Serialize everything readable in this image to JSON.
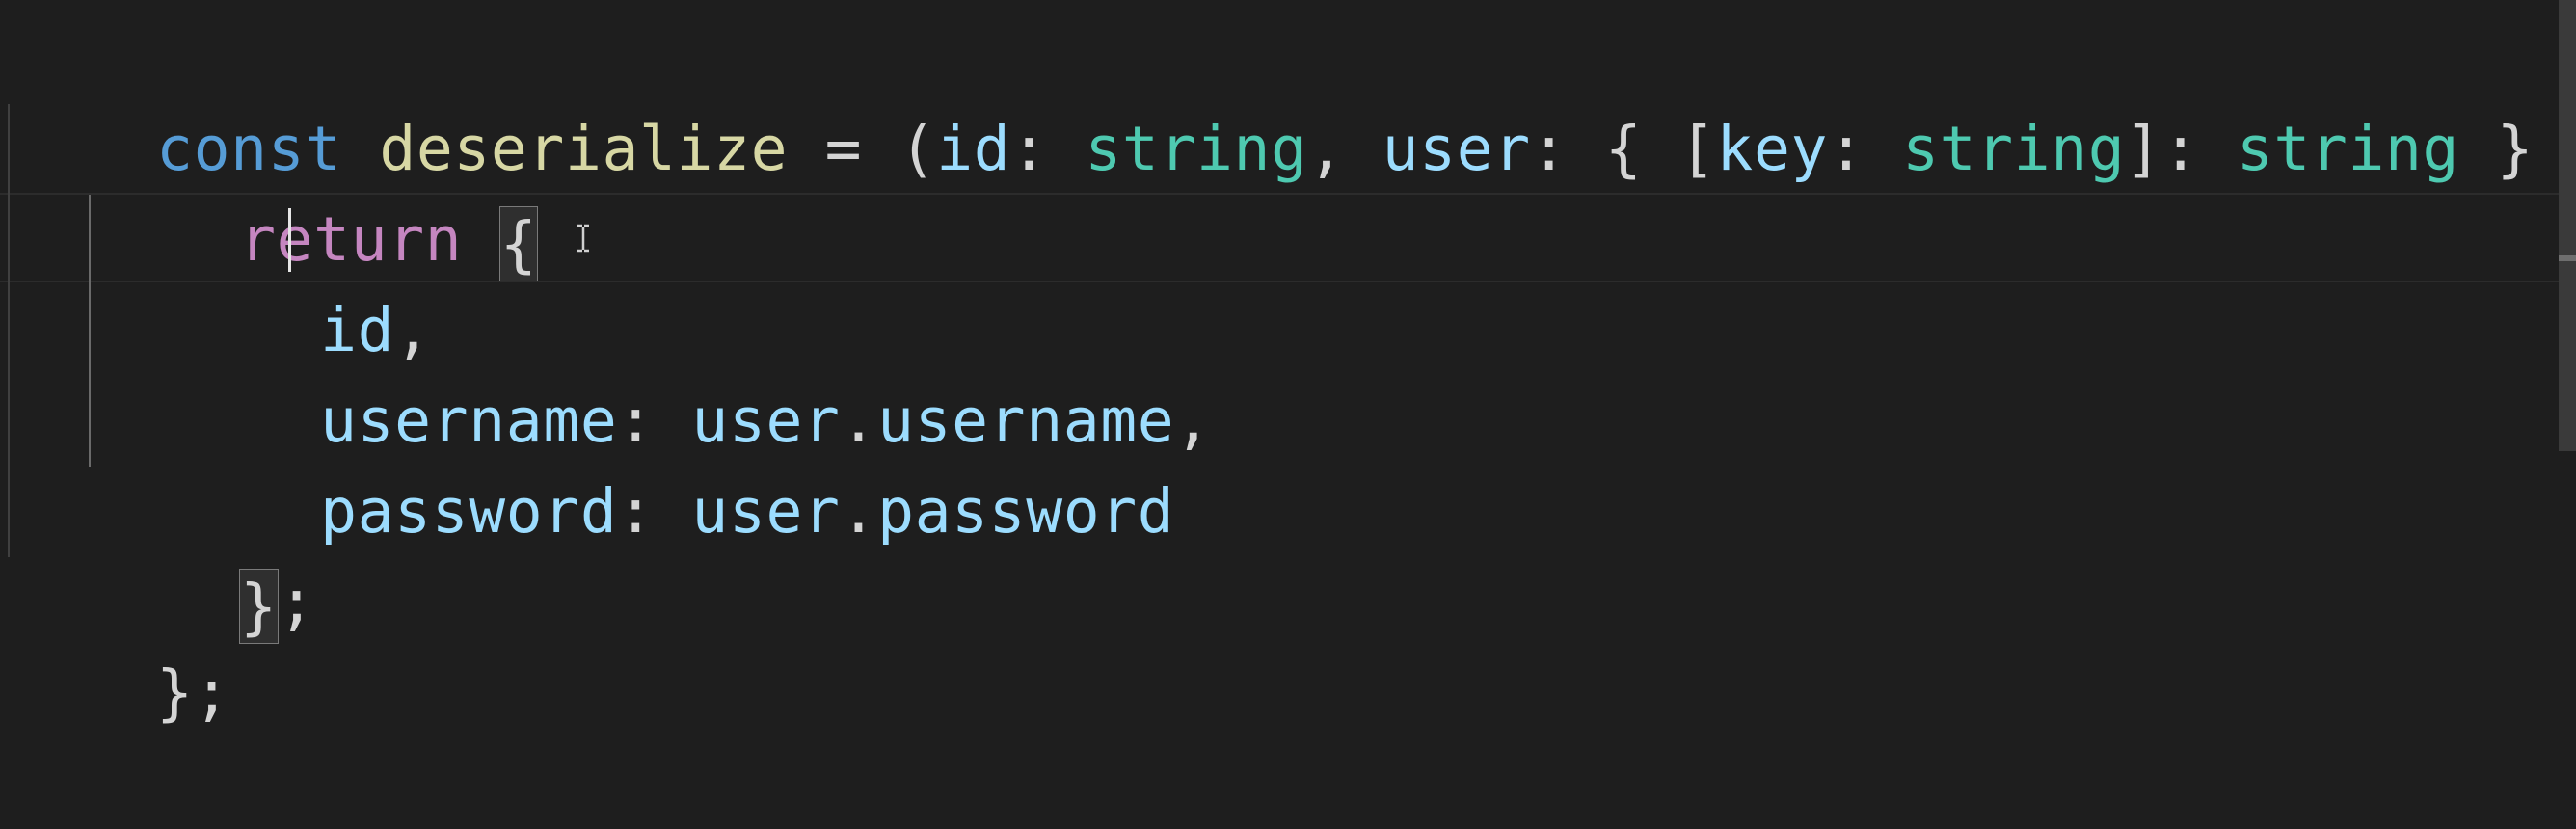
{
  "editor": {
    "language": "typescript",
    "cursor": {
      "line": 3,
      "after": "id,"
    },
    "colors": {
      "background": "#1e1e1e",
      "declaration_keyword": "#569cd6",
      "function_name": "#d7d7a4",
      "variable": "#9cdcfe",
      "type": "#4ec9b0",
      "control_keyword": "#c586c0",
      "punctuation": "#d4d4d4"
    },
    "lines": [
      {
        "tokens": [
          "const",
          " ",
          "deserialize",
          " = (",
          "id",
          ": ",
          "string",
          ", ",
          "user",
          ": { [",
          "key",
          ": ",
          "string",
          "]: ",
          "string",
          " }"
        ]
      },
      {
        "tokens": [
          "return",
          " ",
          "{"
        ]
      },
      {
        "tokens": [
          "id",
          ","
        ]
      },
      {
        "tokens": [
          "username",
          ": ",
          "user",
          ".",
          "username",
          ","
        ]
      },
      {
        "tokens": [
          "password",
          ": ",
          "user",
          ".",
          "password"
        ]
      },
      {
        "tokens": [
          "}",
          ";"
        ]
      },
      {
        "tokens": [
          "};"
        ]
      }
    ]
  },
  "icons": {
    "mouse_pointer": "ibeam-icon"
  }
}
